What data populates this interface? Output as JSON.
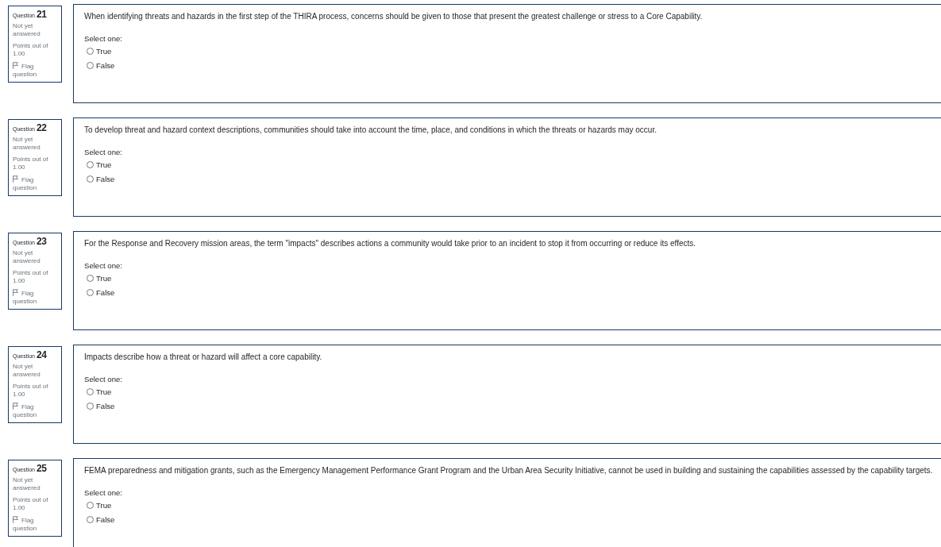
{
  "questions": [
    {
      "heading": "Question",
      "number": "21",
      "status": "Not yet answered",
      "points": "Points out of 1.00",
      "flag": {
        "label": "Flag question",
        "flagged": false
      },
      "text": "When identifying threats and hazards in the first step of the THIRA process, concerns should be given to those that present the greatest challenge or stress to a Core Capability.",
      "prompt": "Select one:",
      "options": [
        {
          "label": "True",
          "selected": false
        },
        {
          "label": "False",
          "selected": false
        }
      ]
    },
    {
      "heading": "Question",
      "number": "22",
      "status": "Not yet answered",
      "points": "Points out of 1.00",
      "flag": {
        "label": "Flag question",
        "flagged": false
      },
      "text": "To develop threat and hazard context descriptions, communities should take into account the time, place, and conditions in which the threats or hazards may occur.",
      "prompt": "Select one:",
      "options": [
        {
          "label": "True",
          "selected": false
        },
        {
          "label": "False",
          "selected": false
        }
      ]
    },
    {
      "heading": "Question",
      "number": "23",
      "status": "Not yet answered",
      "points": "Points out of 1.00",
      "flag": {
        "label": "Flag question",
        "flagged": false
      },
      "text": "For the Response and Recovery mission areas, the term \"impacts\" describes actions a community would take prior to an incident to stop it from occurring or reduce its effects.",
      "prompt": "Select one:",
      "options": [
        {
          "label": "True",
          "selected": false
        },
        {
          "label": "False",
          "selected": false
        }
      ]
    },
    {
      "heading": "Question",
      "number": "24",
      "status": "Not yet answered",
      "points": "Points out of 1.00",
      "flag": {
        "label": "Flag question",
        "flagged": false
      },
      "text": "Impacts describe how a threat or hazard will affect a core capability.",
      "prompt": "Select one:",
      "options": [
        {
          "label": "True",
          "selected": false
        },
        {
          "label": "False",
          "selected": false
        }
      ]
    },
    {
      "heading": "Question",
      "number": "25",
      "status": "Not yet answered",
      "points": "Points out of 1.00",
      "flag": {
        "label": "Flag question",
        "flagged": false
      },
      "text": "FEMA preparedness and mitigation grants, such as the Emergency Management Performance Grant Program and the Urban Area Security Initiative, cannot be used in building and sustaining the capabilities assessed by the capability targets.",
      "prompt": "Select one:",
      "options": [
        {
          "label": "True",
          "selected": false
        },
        {
          "label": "False",
          "selected": false
        }
      ]
    }
  ]
}
